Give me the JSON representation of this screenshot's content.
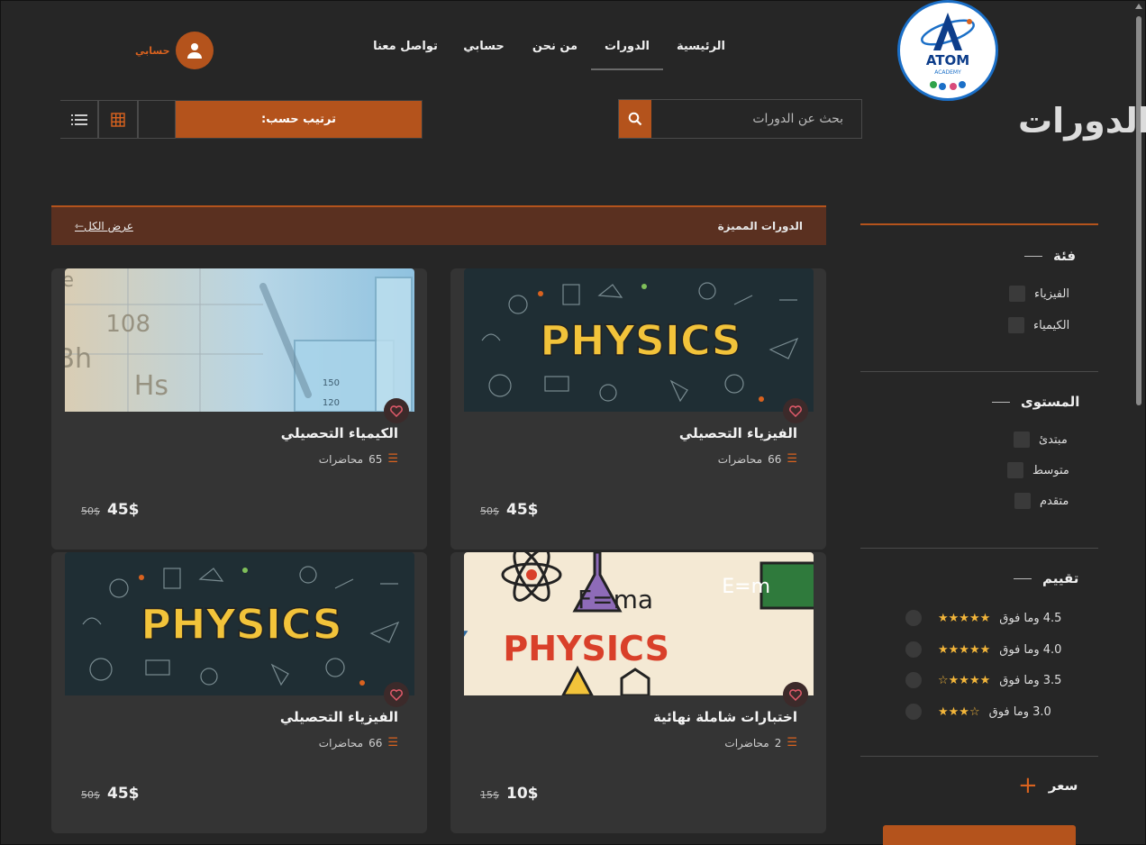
{
  "brand": {
    "name": "ATOM",
    "sub": "ACADEMY"
  },
  "nav": {
    "home": "الرئيسية",
    "courses": "الدورات",
    "about": "من نحن",
    "account": "حسابي",
    "contact": "تواصل معنا"
  },
  "user": {
    "name": "حسابي"
  },
  "page": {
    "title": "الدورات"
  },
  "search": {
    "placeholder": "بحث عن الدورات"
  },
  "sort": {
    "label": "ترتيب حسب:"
  },
  "featured": {
    "title": "الدورات المميزة",
    "view_all": "عرض الكل"
  },
  "courses": [
    {
      "title": "الفيزياء التحصيلي",
      "lectures": "66",
      "lectures_label": "محاضرات",
      "old_price": "50$",
      "price": "45$",
      "image": "physics"
    },
    {
      "title": "الكيمياء التحصيلي",
      "lectures": "65",
      "lectures_label": "محاضرات",
      "old_price": "50$",
      "price": "45$",
      "image": "chemistry-lab"
    },
    {
      "title": "اختبارات شاملة نهائية",
      "lectures": "2",
      "lectures_label": "محاضرات",
      "old_price": "15$",
      "price": "10$",
      "image": "chemistry-physics"
    },
    {
      "title": "الفيزياء التحصيلي",
      "lectures": "66",
      "lectures_label": "محاضرات",
      "old_price": "50$",
      "price": "45$",
      "image": "physics"
    }
  ],
  "sidebar": {
    "category": {
      "title": "فئة",
      "items": [
        "الفيزياء",
        "الكيمياء"
      ]
    },
    "level": {
      "title": "المستوى",
      "items": [
        "مبتدئ",
        "متوسط",
        "متقدم"
      ]
    },
    "rating": {
      "title": "تقييم",
      "items": [
        "4.5 وما فوق",
        "4.0 وما فوق",
        "3.5 وما فوق",
        "3.0 وما فوق"
      ]
    },
    "price": {
      "title": "سعر"
    }
  },
  "colors": {
    "accent": "#b4531c",
    "background": "#262626",
    "card": "#343434"
  }
}
